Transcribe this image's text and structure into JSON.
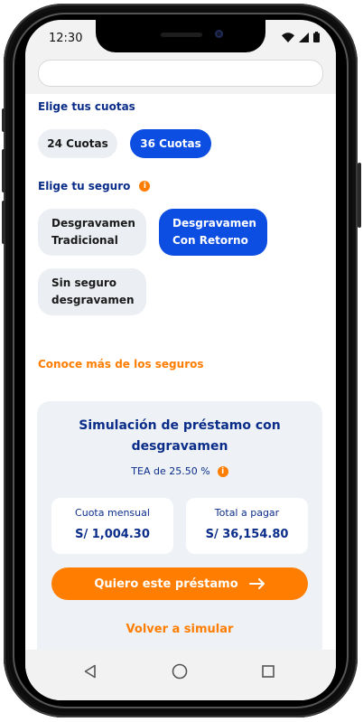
{
  "status_bar": {
    "time": "12:30"
  },
  "installments": {
    "title": "Elige tus cuotas",
    "options": [
      {
        "label": "24 Cuotas",
        "selected": false
      },
      {
        "label": "36 Cuotas",
        "selected": true
      }
    ]
  },
  "insurance": {
    "title": "Elige tu seguro",
    "info_icon": "info-icon",
    "options": [
      {
        "label": "Desgravamen\nTradicional",
        "selected": false
      },
      {
        "label": "Desgravamen\nCon Retorno",
        "selected": true
      },
      {
        "label": "Sin seguro\ndesgravamen",
        "selected": false
      }
    ],
    "more_link": "Conoce más de los seguros"
  },
  "simulation": {
    "title": "Simulación de préstamo con\ndesgravamen",
    "tea_text": "TEA de 25.50 %",
    "monthly_label": "Cuota mensual",
    "monthly_value": "S/ 1,004.30",
    "total_label": "Total a pagar",
    "total_value": "S/ 36,154.80",
    "cta_label": "Quiero este préstamo",
    "cta_icon": "arrow-right-icon",
    "resimulate_label": "Volver a simular"
  },
  "navigation": {
    "back_icon": "back-triangle-icon",
    "home_icon": "home-circle-icon",
    "recents_icon": "recents-square-icon"
  },
  "colors": {
    "brand_blue": "#0b2d8a",
    "selected_chip": "#0c4de2",
    "accent_orange": "#ff7d00",
    "chip_background": "#ebeef2",
    "card_background": "#eef1f5"
  }
}
